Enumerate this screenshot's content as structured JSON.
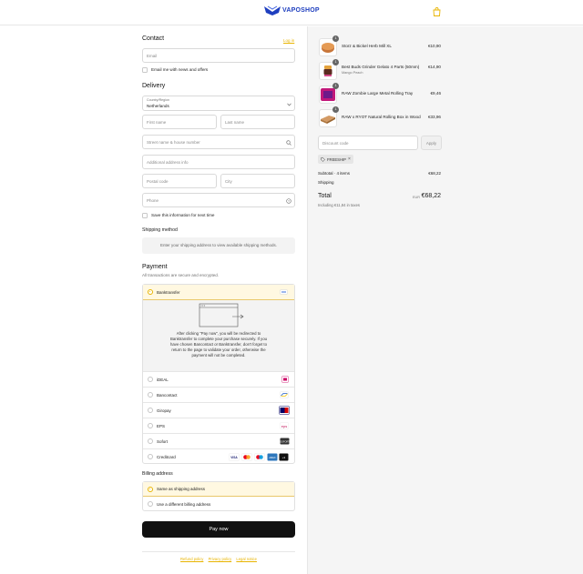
{
  "header": {
    "brand": "VAPOSHOP"
  },
  "contact": {
    "title": "Contact",
    "login_link": "Log in",
    "email_placeholder": "Email",
    "newsletter_label": "Email me with news and offers"
  },
  "delivery": {
    "title": "Delivery",
    "country_label": "Country/Region",
    "country_value": "Netherlands",
    "first_name_placeholder": "First name",
    "last_name_placeholder": "Last name",
    "street_placeholder": "Street name & house number",
    "additional_placeholder": "Additional address info",
    "postal_placeholder": "Postal code",
    "city_placeholder": "City",
    "phone_placeholder": "Phone",
    "save_info_label": "Save this information for next time"
  },
  "shipping": {
    "title": "Shipping method",
    "notice": "Enter your shipping address to view available shipping methods."
  },
  "payment": {
    "title": "Payment",
    "subtitle": "All transactions are secure and encrypted.",
    "selected": "Banktransfer",
    "detail_text": "After clicking \"Pay now\", you will be redirected to Banktransfer to complete your purchase securely. If you have chosen Bancontact or Banktransfer, don't forget to return to the page to validate your order, otherwise the payment will not be completed.",
    "methods": [
      {
        "label": "iDEAL",
        "badge": "iD"
      },
      {
        "label": "Bancontact",
        "badge": "BC"
      },
      {
        "label": "Giropay",
        "badge": "giro"
      },
      {
        "label": "EPS",
        "badge": "eps"
      },
      {
        "label": "Sofort",
        "badge": "SOFORT"
      },
      {
        "label": "Creditcard",
        "badge": "VISA"
      }
    ]
  },
  "billing": {
    "title": "Billing address",
    "same": "Same as shipping address",
    "different": "Use a different billing address"
  },
  "pay_button": "Pay now",
  "footer": {
    "refund": "Refund policy",
    "privacy": "Privacy policy",
    "legal": "Legal notice"
  },
  "order": {
    "items": [
      {
        "name": "Storz & Bickel Herb Mill XL",
        "sub": "",
        "price": "€10,90",
        "qty": "1"
      },
      {
        "name": "Best Buds Grinder Gelato 4 Parts (50mm)",
        "sub": "Mango Peach",
        "price": "€14,90",
        "qty": "1"
      },
      {
        "name": "RAW Zombie Large Metal Rolling Tray",
        "sub": "",
        "price": "€9,46",
        "qty": "1"
      },
      {
        "name": "RAW x RYOT Natural Rolling Box in Wood",
        "sub": "",
        "price": "€33,96",
        "qty": "1"
      }
    ],
    "discount_placeholder": "Discount code",
    "apply_label": "Apply",
    "applied_code": "FREESHIP",
    "subtotal_label": "Subtotal · 4 items",
    "subtotal_value": "€68,22",
    "shipping_label": "Shipping",
    "total_label": "Total",
    "currency": "EUR",
    "total_value": "€68,22",
    "taxes_note": "Including €11,84 in taxes"
  },
  "colors": {
    "accent": "#e8b400",
    "brand": "#1f3fbf",
    "button": "#111111"
  }
}
